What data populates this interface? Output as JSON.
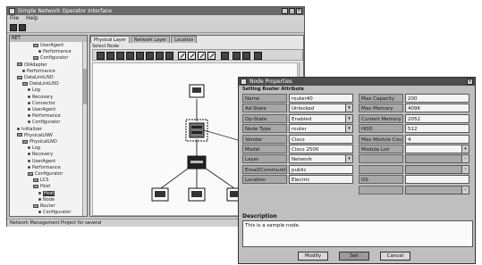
{
  "main_window": {
    "title": "Simple Network Operator Interface",
    "menu": [
      "File",
      "Help"
    ],
    "status_text": "Network Management Project for several"
  },
  "tree": {
    "header": "NET",
    "rows": [
      {
        "indent": 4,
        "glyph": "folder",
        "label": "UserAgent"
      },
      {
        "indent": 5,
        "glyph": "dot",
        "label": "Performance"
      },
      {
        "indent": 4,
        "glyph": "folder",
        "label": "Configurator"
      },
      {
        "indent": 1,
        "glyph": "folder",
        "label": "OtAdapter"
      },
      {
        "indent": 2,
        "glyph": "dot",
        "label": "Performance"
      },
      {
        "indent": 1,
        "glyph": "folder",
        "label": "DataLinkLNO"
      },
      {
        "indent": 2,
        "glyph": "folder",
        "label": "DataLinkLNO"
      },
      {
        "indent": 3,
        "glyph": "dot",
        "label": "Log"
      },
      {
        "indent": 3,
        "glyph": "dot",
        "label": "Recovery"
      },
      {
        "indent": 3,
        "glyph": "dot",
        "label": "Connector"
      },
      {
        "indent": 3,
        "glyph": "dot",
        "label": "UserAgent"
      },
      {
        "indent": 3,
        "glyph": "dot",
        "label": "Performance"
      },
      {
        "indent": 3,
        "glyph": "dot",
        "label": "Configurator"
      },
      {
        "indent": 1,
        "glyph": "dot",
        "label": "Initializer"
      },
      {
        "indent": 1,
        "glyph": "folder",
        "label": "PhysicalLNW"
      },
      {
        "indent": 2,
        "glyph": "folder",
        "label": "PhysicalLNO"
      },
      {
        "indent": 3,
        "glyph": "dot",
        "label": "Log"
      },
      {
        "indent": 3,
        "glyph": "dot",
        "label": "Recovery"
      },
      {
        "indent": 3,
        "glyph": "dot",
        "label": "UserAgent"
      },
      {
        "indent": 3,
        "glyph": "dot",
        "label": "Performance"
      },
      {
        "indent": 3,
        "glyph": "folder",
        "label": "Configurator"
      },
      {
        "indent": 4,
        "glyph": "folder",
        "label": "LCS"
      },
      {
        "indent": 4,
        "glyph": "folder",
        "label": "Host"
      },
      {
        "indent": 5,
        "glyph": "dot",
        "label": "Host",
        "selected": true
      },
      {
        "indent": 5,
        "glyph": "dot",
        "label": "Node"
      },
      {
        "indent": 4,
        "glyph": "folder",
        "label": "Router"
      },
      {
        "indent": 5,
        "glyph": "dot",
        "label": "Configurator"
      }
    ]
  },
  "editor": {
    "tabs": [
      "Physical Layer",
      "Network Layer",
      "Location"
    ],
    "section_label": "Select Node"
  },
  "dialog": {
    "title": "Node Properties",
    "subheader": "Setting Router Attribute",
    "left_fields": [
      {
        "label": "Name",
        "value": "router40",
        "dropdown": false
      },
      {
        "label": "Ad-State",
        "value": "Unlocked",
        "dropdown": true
      },
      {
        "label": "Op-State",
        "value": "Enabled",
        "dropdown": true
      },
      {
        "label": "Node Type",
        "value": "router",
        "dropdown": true
      },
      {
        "label": "Vendor",
        "value": "Cisco",
        "dropdown": false
      },
      {
        "label": "Model",
        "value": "Cisco 2500",
        "dropdown": false
      },
      {
        "label": "Layer",
        "value": "Network",
        "dropdown": true
      },
      {
        "label": "Email/Community",
        "value": "public",
        "dropdown": false
      },
      {
        "label": "Location",
        "value": "Electric",
        "dropdown": false
      }
    ],
    "right_fields": [
      {
        "label": "Max Capacity",
        "value": "200",
        "dropdown": false,
        "disabled": false
      },
      {
        "label": "Max Memory",
        "value": "4096",
        "dropdown": false,
        "disabled": false
      },
      {
        "label": "Current Memory",
        "value": "2052",
        "dropdown": false,
        "disabled": false
      },
      {
        "label": "HDD",
        "value": "512",
        "dropdown": false,
        "disabled": false
      },
      {
        "label": "Max Module Count",
        "value": "4",
        "dropdown": false,
        "disabled": false
      },
      {
        "label": "Module List",
        "value": "",
        "dropdown": true,
        "disabled": false
      },
      {
        "label": "",
        "value": "",
        "dropdown": true,
        "disabled": true
      },
      {
        "label": "",
        "value": "",
        "dropdown": true,
        "disabled": true
      },
      {
        "label": "OS",
        "value": "",
        "dropdown": false,
        "disabled": false
      },
      {
        "label": "",
        "value": "",
        "dropdown": true,
        "disabled": true
      }
    ],
    "description_label": "Description",
    "description_text": "This is a sample node.",
    "buttons": [
      "Modify",
      "Set",
      "Cancel"
    ]
  }
}
